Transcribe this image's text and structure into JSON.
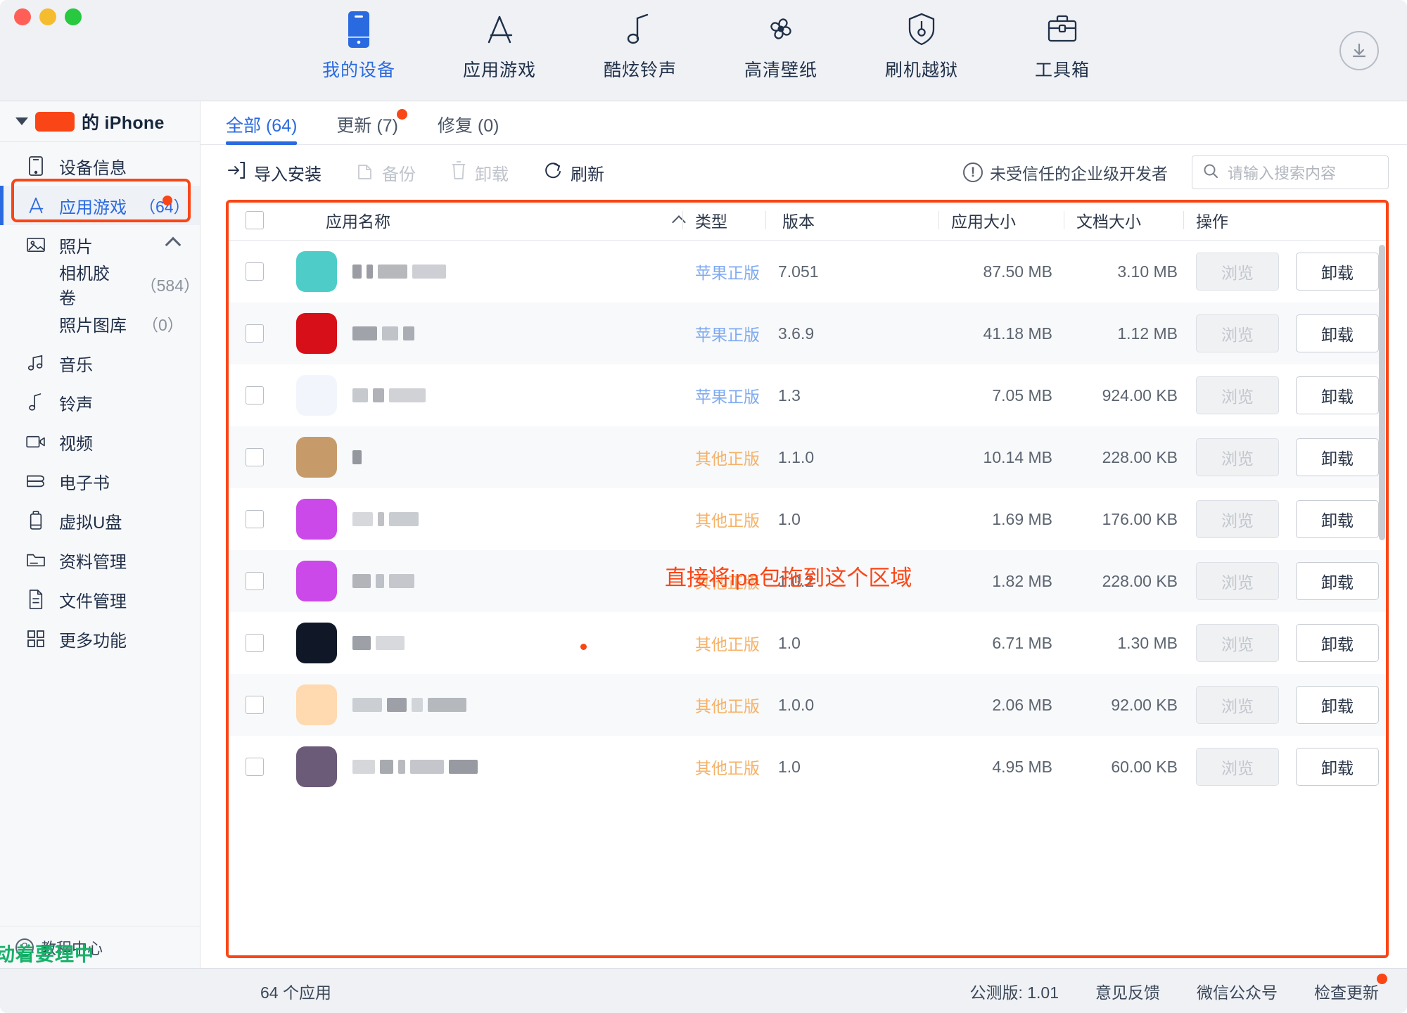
{
  "window": {
    "traffic_lights": [
      "close",
      "minimize",
      "zoom"
    ]
  },
  "toolbar": {
    "items": [
      {
        "label": "我的设备",
        "icon": "phone-icon",
        "active": true
      },
      {
        "label": "应用游戏",
        "icon": "appstore-icon",
        "active": false
      },
      {
        "label": "酷炫铃声",
        "icon": "music-note-icon",
        "active": false
      },
      {
        "label": "高清壁纸",
        "icon": "clover-icon",
        "active": false
      },
      {
        "label": "刷机越狱",
        "icon": "shield-key-icon",
        "active": false
      },
      {
        "label": "工具箱",
        "icon": "toolbox-icon",
        "active": false
      }
    ],
    "download_icon": "download-icon"
  },
  "sidebar": {
    "device": {
      "name_redacted": true,
      "suffix": "的 iPhone",
      "expanded": true
    },
    "items": [
      {
        "label": "设备信息",
        "icon": "device-info-icon",
        "count": "",
        "active": false,
        "sub": false,
        "badge": false
      },
      {
        "label": "应用游戏",
        "icon": "appstore-icon",
        "count": "（64）",
        "active": true,
        "sub": false,
        "badge": true
      },
      {
        "label": "照片",
        "icon": "photo-icon",
        "count": "",
        "active": false,
        "sub": false,
        "badge": false,
        "chevron": "up"
      },
      {
        "label": "相机胶卷",
        "icon": "",
        "count": "（584）",
        "active": false,
        "sub": true,
        "badge": false
      },
      {
        "label": "照片图库",
        "icon": "",
        "count": "（0）",
        "active": false,
        "sub": true,
        "badge": false
      },
      {
        "label": "音乐",
        "icon": "music-icon",
        "count": "",
        "active": false,
        "sub": false,
        "badge": false
      },
      {
        "label": "铃声",
        "icon": "ringtone-icon",
        "count": "",
        "active": false,
        "sub": false,
        "badge": false
      },
      {
        "label": "视频",
        "icon": "video-icon",
        "count": "",
        "active": false,
        "sub": false,
        "badge": false
      },
      {
        "label": "电子书",
        "icon": "book-icon",
        "count": "",
        "active": false,
        "sub": false,
        "badge": false
      },
      {
        "label": "虚拟U盘",
        "icon": "usb-icon",
        "count": "",
        "active": false,
        "sub": false,
        "badge": false
      },
      {
        "label": "资料管理",
        "icon": "folder-icon",
        "count": "",
        "active": false,
        "sub": false,
        "badge": false
      },
      {
        "label": "文件管理",
        "icon": "file-icon",
        "count": "",
        "active": false,
        "sub": false,
        "badge": false
      },
      {
        "label": "更多功能",
        "icon": "grid-icon",
        "count": "",
        "active": false,
        "sub": false,
        "badge": false
      }
    ],
    "footer": {
      "label": "教程中心",
      "icon": "question-icon"
    },
    "overlay_note": "动着要理中"
  },
  "tabs": [
    {
      "label": "全部 (64)",
      "active": true,
      "badge": false
    },
    {
      "label": "更新 (7)",
      "active": false,
      "badge": true
    },
    {
      "label": "修复 (0)",
      "active": false,
      "badge": false
    }
  ],
  "actionbar": {
    "buttons": [
      {
        "label": "导入安装",
        "icon": "import-icon",
        "disabled": false
      },
      {
        "label": "备份",
        "icon": "backup-icon",
        "disabled": true
      },
      {
        "label": "卸载",
        "icon": "trash-icon",
        "disabled": true
      },
      {
        "label": "刷新",
        "icon": "refresh-icon",
        "disabled": false
      }
    ],
    "warning": {
      "label": "未受信任的企业级开发者",
      "icon": "exclamation-circle-icon"
    },
    "search": {
      "placeholder": "请输入搜索内容",
      "value": "",
      "icon": "search-icon"
    }
  },
  "table": {
    "columns": [
      "应用名称",
      "类型",
      "版本",
      "应用大小",
      "文档大小",
      "操作"
    ],
    "sort": {
      "column": "应用名称",
      "direction": "asc"
    },
    "rows": [
      {
        "type": "苹果正版",
        "type_kind": "apple",
        "version": "7.051",
        "app_size": "87.50 MB",
        "doc_size": "3.10 MB",
        "browse": "浏览",
        "uninstall": "卸载",
        "icon_color": "#4ecdc8",
        "name_hidden": true,
        "red_dot": false
      },
      {
        "type": "苹果正版",
        "type_kind": "apple",
        "version": "3.6.9",
        "app_size": "41.18 MB",
        "doc_size": "1.12 MB",
        "browse": "浏览",
        "uninstall": "卸载",
        "icon_color": "#d60f19",
        "name_hidden": true,
        "red_dot": false
      },
      {
        "type": "苹果正版",
        "type_kind": "apple",
        "version": "1.3",
        "app_size": "7.05 MB",
        "doc_size": "924.00 KB",
        "browse": "浏览",
        "uninstall": "卸载",
        "icon_color": "#f2f6fc",
        "name_hidden": true,
        "red_dot": false
      },
      {
        "type": "其他正版",
        "type_kind": "other",
        "version": "1.1.0",
        "app_size": "10.14 MB",
        "doc_size": "228.00 KB",
        "browse": "浏览",
        "uninstall": "卸载",
        "icon_color": "#c79a6a",
        "name_hidden": true,
        "red_dot": false
      },
      {
        "type": "其他正版",
        "type_kind": "other",
        "version": "1.0",
        "app_size": "1.69 MB",
        "doc_size": "176.00 KB",
        "browse": "浏览",
        "uninstall": "卸载",
        "icon_color": "#cb49e8",
        "name_hidden": true,
        "red_dot": false
      },
      {
        "type": "其他正版",
        "type_kind": "other",
        "version": "1.0.2",
        "app_size": "1.82 MB",
        "doc_size": "228.00 KB",
        "browse": "浏览",
        "uninstall": "卸载",
        "icon_color": "#cb49e8",
        "name_hidden": true,
        "red_dot": false
      },
      {
        "type": "其他正版",
        "type_kind": "other",
        "version": "1.0",
        "app_size": "6.71 MB",
        "doc_size": "1.30 MB",
        "browse": "浏览",
        "uninstall": "卸载",
        "icon_color": "#101828",
        "name_hidden": true,
        "red_dot": true
      },
      {
        "type": "其他正版",
        "type_kind": "other",
        "version": "1.0.0",
        "app_size": "2.06 MB",
        "doc_size": "92.00 KB",
        "browse": "浏览",
        "uninstall": "卸载",
        "icon_color": "#ffd9b0",
        "name_hidden": true,
        "red_dot": false
      },
      {
        "type": "其他正版",
        "type_kind": "other",
        "version": "1.0",
        "app_size": "4.95 MB",
        "doc_size": "60.00 KB",
        "browse": "浏览",
        "uninstall": "卸载",
        "icon_color": "#6b5a78",
        "name_hidden": true,
        "red_dot": false
      }
    ]
  },
  "annotation": {
    "drop_hint": "直接将ipa包拖到这个区域"
  },
  "statusbar": {
    "count": "64 个应用",
    "version": "公测版: 1.01",
    "links": [
      {
        "label": "意见反馈",
        "badge": false
      },
      {
        "label": "微信公众号",
        "badge": false
      },
      {
        "label": "检查更新",
        "badge": true
      }
    ]
  }
}
